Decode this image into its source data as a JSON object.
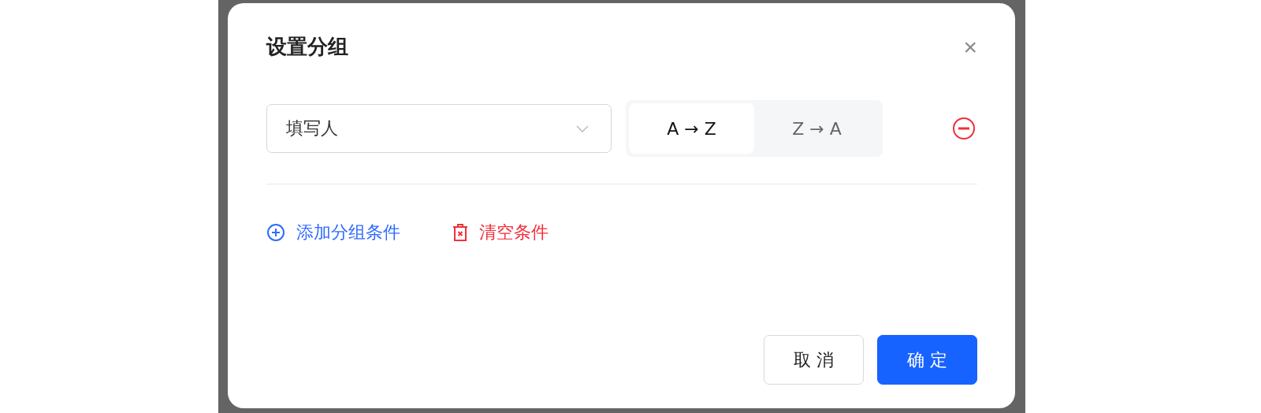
{
  "dialog": {
    "title": "设置分组",
    "close": "×"
  },
  "conditions": [
    {
      "field": "填写人",
      "orders": [
        {
          "label": "A → Z",
          "selected": true
        },
        {
          "label": "Z → A",
          "selected": false
        }
      ]
    }
  ],
  "actions": [
    {
      "kind": "add",
      "label": "添加分组条件"
    },
    {
      "kind": "clear",
      "label": "清空条件"
    }
  ],
  "buttons": [
    {
      "kind": "secondary",
      "label": "取 消"
    },
    {
      "kind": "primary",
      "label": "确 定"
    }
  ]
}
